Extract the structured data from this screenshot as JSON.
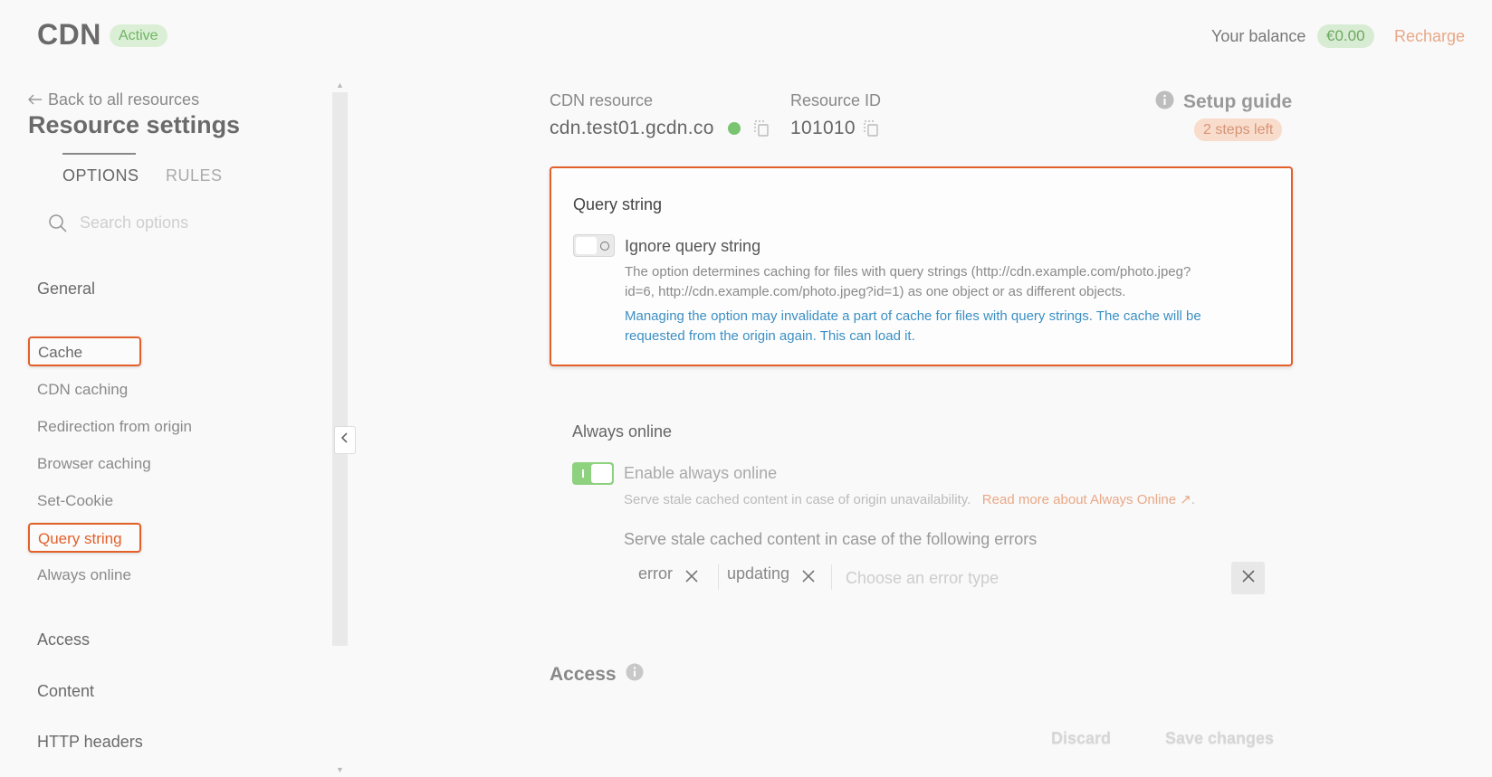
{
  "header": {
    "app_title": "CDN",
    "status": "Active",
    "balance_label": "Your balance",
    "balance_value": "€0.00",
    "recharge_label": "Recharge"
  },
  "sidebar": {
    "back_label": "Back to all resources",
    "title": "Resource settings",
    "tabs": [
      {
        "label": "OPTIONS",
        "active": true
      },
      {
        "label": "RULES",
        "active": false
      }
    ],
    "search_placeholder": "Search options",
    "sections": {
      "general": "General",
      "cache": "Cache",
      "cache_items": [
        "CDN caching",
        "Redirection from origin",
        "Browser caching",
        "Set-Cookie",
        "Query string",
        "Always online"
      ],
      "access": "Access",
      "content": "Content",
      "http_headers": "HTTP headers"
    }
  },
  "resource": {
    "cdn_label": "CDN resource",
    "cdn_value": "cdn.test01.gcdn.co",
    "id_label": "Resource ID",
    "id_value": "101010"
  },
  "setup_guide": {
    "label": "Setup guide",
    "steps_left": "2 steps left"
  },
  "query_string": {
    "title": "Query string",
    "toggle_label": "Ignore query string",
    "toggle_on": false,
    "description_line1": "The option determines caching for files with query strings (http://cdn.example.com/photo.jpeg?",
    "description_line2": "id=6, http://cdn.example.com/photo.jpeg?id=1) as one object or as different objects.",
    "warning_line1": "Managing the option may invalidate a part of cache for files with query strings. The cache will be",
    "warning_line2": "requested from the origin again. This can load it."
  },
  "always_online": {
    "title": "Always online",
    "toggle_label": "Enable always online",
    "toggle_on": true,
    "description": "Serve stale cached content in case of origin unavailability.",
    "read_more": "Read more about Always Online",
    "errors_label": "Serve stale cached content in case of the following errors",
    "chips": [
      "error",
      "updating"
    ],
    "input_placeholder": "Choose an error type"
  },
  "access_section": {
    "title": "Access"
  },
  "footer": {
    "discard_label": "Discard",
    "save_label": "Save changes"
  },
  "colors": {
    "accent_orange": "#e3602b",
    "link_blue": "#3b8fc4",
    "success_green": "#78c470",
    "recharge_peach": "#e9a887"
  }
}
